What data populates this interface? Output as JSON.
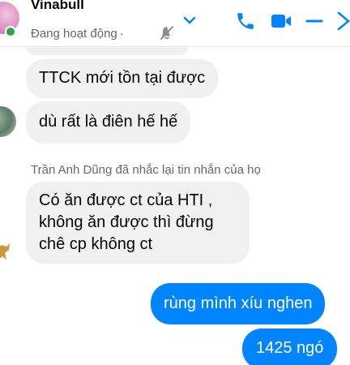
{
  "header": {
    "name": "Vinabull",
    "status": "Đang hoạt động",
    "separator": "·",
    "icons": [
      "mute-icon",
      "chevron-down-icon",
      "phone-icon",
      "video-camera-icon",
      "minimize-icon",
      "close-icon"
    ],
    "accent_color": "#0084ff",
    "online_color": "#31a24c"
  },
  "messages": {
    "m1": "TTCK mới tồn tại được",
    "m2": "dù rất là điên hế hế",
    "reply_note": "Trần Anh Dũng đã nhắc lại tin nhắn của họ",
    "m3": "Có ăn được ct của HTI , không ăn được thì đừng chê cp không ct",
    "m4": "rùng mình xíu nghen",
    "m5": "1425 ngó"
  }
}
